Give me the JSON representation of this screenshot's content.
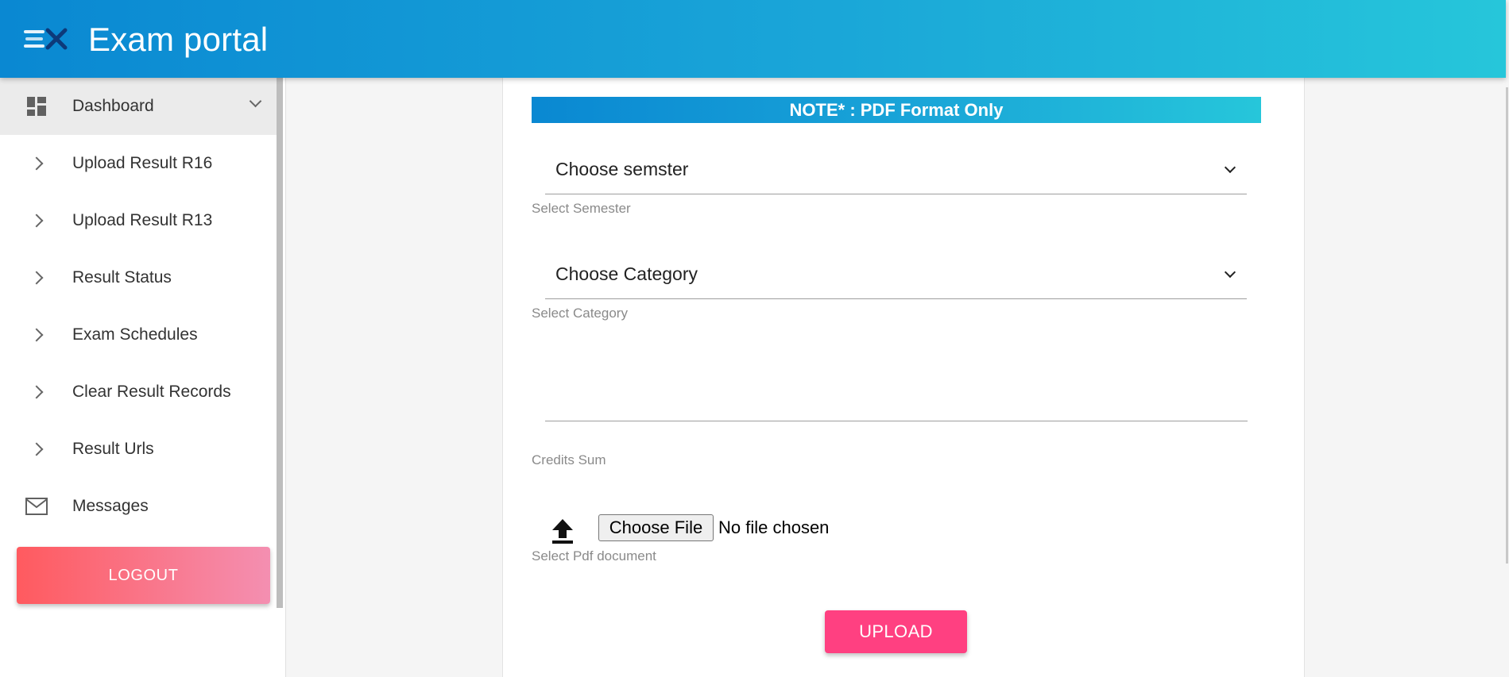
{
  "header": {
    "title": "Exam portal",
    "logo_icon": "ex-logo-icon"
  },
  "sidebar": {
    "items": [
      {
        "label": "Dashboard",
        "icon": "dashboard-icon",
        "active": true
      },
      {
        "label": "Upload Result R16",
        "icon": "chevron-right-icon"
      },
      {
        "label": "Upload Result R13",
        "icon": "chevron-right-icon"
      },
      {
        "label": "Result Status",
        "icon": "chevron-right-icon"
      },
      {
        "label": "Exam Schedules",
        "icon": "chevron-right-icon"
      },
      {
        "label": "Clear Result Records",
        "icon": "chevron-right-icon"
      },
      {
        "label": "Result Urls",
        "icon": "chevron-right-icon"
      },
      {
        "label": "Messages",
        "icon": "mail-icon"
      }
    ],
    "logout_label": "LOGOUT"
  },
  "form": {
    "note": "NOTE* : PDF Format Only",
    "semester_value": "Choose semster",
    "semester_helper": "Select Semester",
    "category_value": "Choose Category",
    "category_helper": "Select Category",
    "credits_helper": "Credits Sum",
    "file_button": "Choose File",
    "file_status": "No file chosen",
    "file_helper": "Select Pdf document",
    "upload_label": "UPLOAD"
  },
  "colors": {
    "header_start": "#0a88d2",
    "header_end": "#26c6da",
    "logout_start": "#ff5a5f",
    "logout_end": "#f48fb1",
    "upload": "#ff4081"
  }
}
